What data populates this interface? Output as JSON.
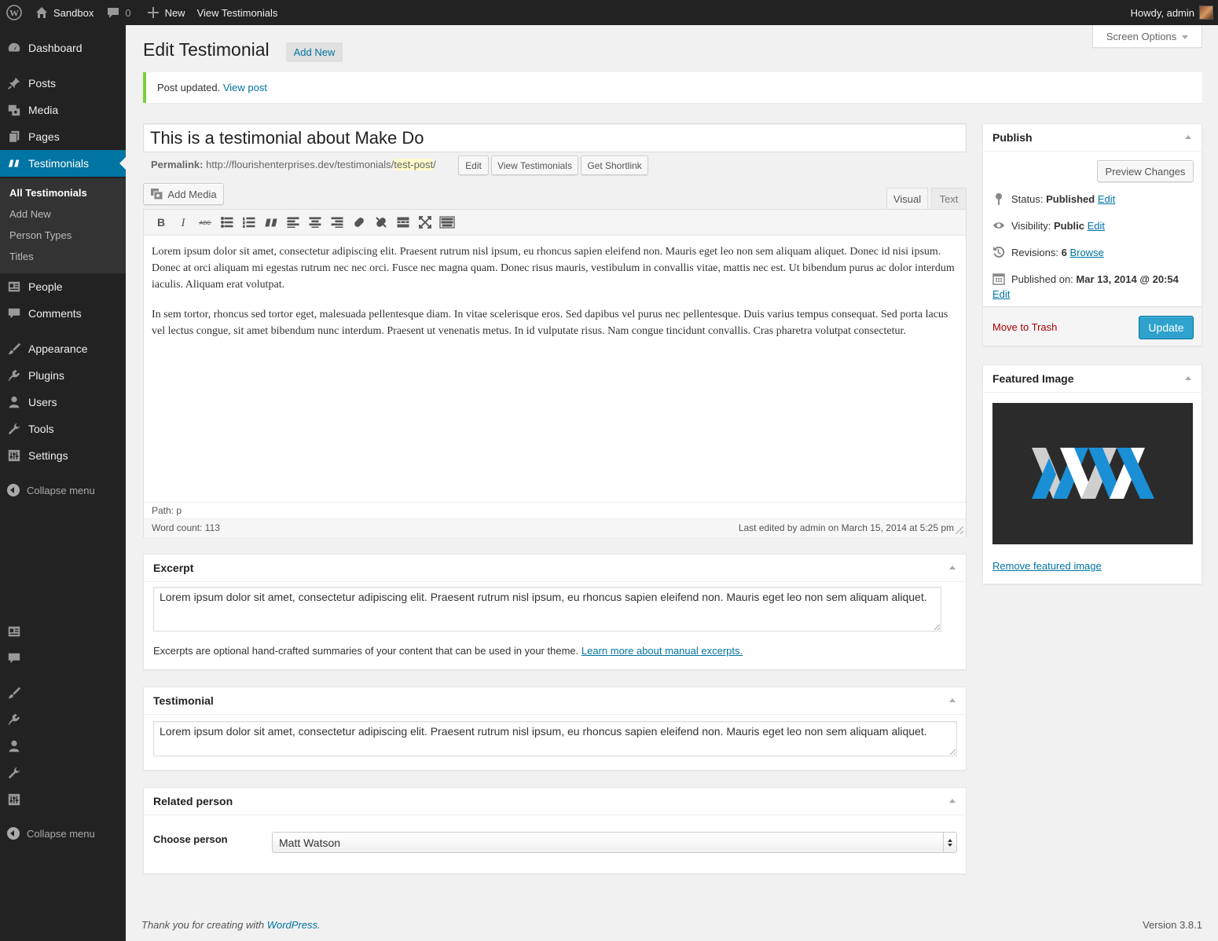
{
  "adminbar": {
    "site_name": "Sandbox",
    "comments_count": "0",
    "new_label": "New",
    "view_label": "View Testimonials",
    "howdy": "Howdy, admin"
  },
  "sidebar": {
    "items": [
      {
        "label": "Dashboard",
        "icon": "dashboard-icon"
      },
      {
        "label": "Posts",
        "icon": "pushpin-icon"
      },
      {
        "label": "Media",
        "icon": "media-icon"
      },
      {
        "label": "Pages",
        "icon": "pages-icon"
      },
      {
        "label": "Testimonials",
        "icon": "quote-icon"
      },
      {
        "label": "People",
        "icon": "id-card-icon"
      },
      {
        "label": "Comments",
        "icon": "comment-icon"
      },
      {
        "label": "Appearance",
        "icon": "paintbrush-icon"
      },
      {
        "label": "Plugins",
        "icon": "plug-icon"
      },
      {
        "label": "Users",
        "icon": "user-icon"
      },
      {
        "label": "Tools",
        "icon": "wrench-icon"
      },
      {
        "label": "Settings",
        "icon": "sliders-icon"
      }
    ],
    "submenu": [
      "All Testimonials",
      "Add New",
      "Person Types",
      "Titles"
    ],
    "collapse_label": "Collapse menu"
  },
  "header": {
    "title": "Edit Testimonial",
    "add_new": "Add New",
    "screen_options": "Screen Options"
  },
  "notice": {
    "text": "Post updated.",
    "link": "View post"
  },
  "editor": {
    "post_title": "This is a testimonial about Make Do",
    "permalink_label": "Permalink:",
    "permalink_base": "http://flourishenterprises.dev/testimonials/",
    "permalink_slug": "test-post",
    "permalink_end": "/",
    "edit_btn": "Edit",
    "view_btn": "View Testimonials",
    "shortlink_btn": "Get Shortlink",
    "add_media": "Add Media",
    "tab_visual": "Visual",
    "tab_text": "Text",
    "content_p1": "Lorem ipsum dolor sit amet, consectetur adipiscing elit. Praesent rutrum nisl ipsum, eu rhoncus sapien eleifend non. Mauris eget leo non sem aliquam aliquet. Donec id nisi ipsum. Donec at orci aliquam mi egestas rutrum nec nec orci. Fusce nec magna quam. Donec risus mauris, vestibulum in convallis vitae, mattis nec est. Ut bibendum purus ac dolor interdum iaculis. Aliquam erat volutpat.",
    "content_p2": "In sem tortor, rhoncus sed tortor eget, malesuada pellentesque diam. In vitae scelerisque eros. Sed dapibus vel purus nec pellentesque. Duis varius tempus consequat. Sed porta lacus vel lectus congue, sit amet bibendum nunc interdum. Praesent ut venenatis metus. In id vulputate risus. Nam congue tincidunt convallis. Cras pharetra volutpat consectetur.",
    "path": "Path: p",
    "word_count": "Word count: 113",
    "last_edited": "Last edited by admin on March 15, 2014 at 5:25 pm"
  },
  "excerpt": {
    "title": "Excerpt",
    "value": "Lorem ipsum dolor sit amet, consectetur adipiscing elit. Praesent rutrum nisl ipsum, eu rhoncus sapien eleifend non. Mauris eget leo non sem aliquam aliquet.",
    "help": "Excerpts are optional hand-crafted summaries of your content that can be used in your theme.",
    "help_link": "Learn more about manual excerpts."
  },
  "testimonial": {
    "title": "Testimonial",
    "value": "Lorem ipsum dolor sit amet, consectetur adipiscing elit. Praesent rutrum nisl ipsum, eu rhoncus sapien eleifend non. Mauris eget leo non sem aliquam aliquet."
  },
  "related": {
    "title": "Related person",
    "label": "Choose person",
    "selected": "Matt Watson"
  },
  "publish": {
    "title": "Publish",
    "preview": "Preview Changes",
    "status_label": "Status:",
    "status_value": "Published",
    "visibility_label": "Visibility:",
    "visibility_value": "Public",
    "revisions_label": "Revisions:",
    "revisions_value": "6",
    "browse": "Browse",
    "published_label": "Published on:",
    "published_value": "Mar 13, 2014 @ 20:54",
    "edit": "Edit",
    "trash": "Move to Trash",
    "update": "Update"
  },
  "featured": {
    "title": "Featured Image",
    "remove": "Remove featured image"
  },
  "footer": {
    "thanks": "Thank you for creating with",
    "wp": "WordPress",
    "period": ".",
    "version": "Version 3.8.1"
  },
  "colors": {
    "accent": "#0074a2",
    "update_button": "#2ea2cc",
    "notice_border": "#7ad03a",
    "trash": "#a00",
    "featured_bg": "#2b2b2b",
    "logo_blue": "#1a8fd6"
  }
}
